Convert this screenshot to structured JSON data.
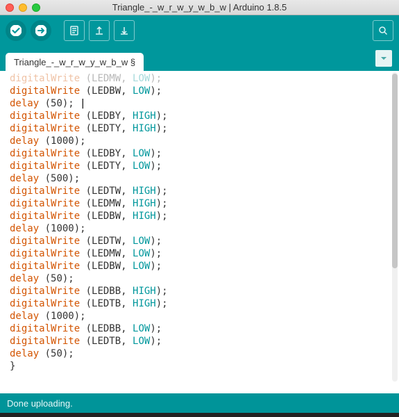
{
  "window": {
    "title": "Triangle_-_w_r_w_y_w_b_w | Arduino 1.8.5"
  },
  "tab": {
    "label": "Triangle_-_w_r_w_y_w_b_w §"
  },
  "status": {
    "text": "Done uploading."
  },
  "code": {
    "lines": [
      {
        "parts": [
          {
            "t": "digitalWrite",
            "c": "cut"
          },
          {
            "t": " (LEDMW, ",
            "c": "cut-plain"
          },
          {
            "t": "LOW",
            "c": "cut-const"
          },
          {
            "t": ");",
            "c": "cut-plain"
          }
        ]
      },
      {
        "parts": [
          {
            "t": "digitalWrite",
            "c": "kw-fn"
          },
          {
            "t": " (LEDBW, ",
            "c": "plain"
          },
          {
            "t": "LOW",
            "c": "kw-const"
          },
          {
            "t": ");",
            "c": "plain"
          }
        ]
      },
      {
        "parts": [
          {
            "t": "delay",
            "c": "kw-fn"
          },
          {
            "t": " (50); ",
            "c": "plain"
          }
        ],
        "caret": true
      },
      {
        "parts": [
          {
            "t": "digitalWrite",
            "c": "kw-fn"
          },
          {
            "t": " (LEDBY, ",
            "c": "plain"
          },
          {
            "t": "HIGH",
            "c": "kw-const"
          },
          {
            "t": ");",
            "c": "plain"
          }
        ]
      },
      {
        "parts": [
          {
            "t": "digitalWrite",
            "c": "kw-fn"
          },
          {
            "t": " (LEDTY, ",
            "c": "plain"
          },
          {
            "t": "HIGH",
            "c": "kw-const"
          },
          {
            "t": ");",
            "c": "plain"
          }
        ]
      },
      {
        "parts": [
          {
            "t": "delay",
            "c": "kw-fn"
          },
          {
            "t": " (1000);",
            "c": "plain"
          }
        ]
      },
      {
        "parts": [
          {
            "t": "digitalWrite",
            "c": "kw-fn"
          },
          {
            "t": " (LEDBY, ",
            "c": "plain"
          },
          {
            "t": "LOW",
            "c": "kw-const"
          },
          {
            "t": ");",
            "c": "plain"
          }
        ]
      },
      {
        "parts": [
          {
            "t": "digitalWrite",
            "c": "kw-fn"
          },
          {
            "t": " (LEDTY, ",
            "c": "plain"
          },
          {
            "t": "LOW",
            "c": "kw-const"
          },
          {
            "t": ");",
            "c": "plain"
          }
        ]
      },
      {
        "parts": [
          {
            "t": "delay",
            "c": "kw-fn"
          },
          {
            "t": " (500);",
            "c": "plain"
          }
        ]
      },
      {
        "parts": [
          {
            "t": "digitalWrite",
            "c": "kw-fn"
          },
          {
            "t": " (LEDTW, ",
            "c": "plain"
          },
          {
            "t": "HIGH",
            "c": "kw-const"
          },
          {
            "t": ");",
            "c": "plain"
          }
        ]
      },
      {
        "parts": [
          {
            "t": "digitalWrite",
            "c": "kw-fn"
          },
          {
            "t": " (LEDMW, ",
            "c": "plain"
          },
          {
            "t": "HIGH",
            "c": "kw-const"
          },
          {
            "t": ");",
            "c": "plain"
          }
        ]
      },
      {
        "parts": [
          {
            "t": "digitalWrite",
            "c": "kw-fn"
          },
          {
            "t": " (LEDBW, ",
            "c": "plain"
          },
          {
            "t": "HIGH",
            "c": "kw-const"
          },
          {
            "t": ");",
            "c": "plain"
          }
        ]
      },
      {
        "parts": [
          {
            "t": "delay",
            "c": "kw-fn"
          },
          {
            "t": " (1000);",
            "c": "plain"
          }
        ]
      },
      {
        "parts": [
          {
            "t": "digitalWrite",
            "c": "kw-fn"
          },
          {
            "t": " (LEDTW, ",
            "c": "plain"
          },
          {
            "t": "LOW",
            "c": "kw-const"
          },
          {
            "t": ");",
            "c": "plain"
          }
        ]
      },
      {
        "parts": [
          {
            "t": "digitalWrite",
            "c": "kw-fn"
          },
          {
            "t": " (LEDMW, ",
            "c": "plain"
          },
          {
            "t": "LOW",
            "c": "kw-const"
          },
          {
            "t": ");",
            "c": "plain"
          }
        ]
      },
      {
        "parts": [
          {
            "t": "digitalWrite",
            "c": "kw-fn"
          },
          {
            "t": " (LEDBW, ",
            "c": "plain"
          },
          {
            "t": "LOW",
            "c": "kw-const"
          },
          {
            "t": ");",
            "c": "plain"
          }
        ]
      },
      {
        "parts": [
          {
            "t": "delay",
            "c": "kw-fn"
          },
          {
            "t": " (50);",
            "c": "plain"
          }
        ]
      },
      {
        "parts": [
          {
            "t": "digitalWrite",
            "c": "kw-fn"
          },
          {
            "t": " (LEDBB, ",
            "c": "plain"
          },
          {
            "t": "HIGH",
            "c": "kw-const"
          },
          {
            "t": ");",
            "c": "plain"
          }
        ]
      },
      {
        "parts": [
          {
            "t": "digitalWrite",
            "c": "kw-fn"
          },
          {
            "t": " (LEDTB, ",
            "c": "plain"
          },
          {
            "t": "HIGH",
            "c": "kw-const"
          },
          {
            "t": ");",
            "c": "plain"
          }
        ]
      },
      {
        "parts": [
          {
            "t": "delay",
            "c": "kw-fn"
          },
          {
            "t": " (1000);",
            "c": "plain"
          }
        ]
      },
      {
        "parts": [
          {
            "t": "digitalWrite",
            "c": "kw-fn"
          },
          {
            "t": " (LEDBB, ",
            "c": "plain"
          },
          {
            "t": "LOW",
            "c": "kw-const"
          },
          {
            "t": ");",
            "c": "plain"
          }
        ]
      },
      {
        "parts": [
          {
            "t": "digitalWrite",
            "c": "kw-fn"
          },
          {
            "t": " (LEDTB, ",
            "c": "plain"
          },
          {
            "t": "LOW",
            "c": "kw-const"
          },
          {
            "t": ");",
            "c": "plain"
          }
        ]
      },
      {
        "parts": [
          {
            "t": "delay",
            "c": "kw-fn"
          },
          {
            "t": " (50);",
            "c": "plain"
          }
        ]
      },
      {
        "parts": [
          {
            "t": "}",
            "c": "plain"
          }
        ]
      }
    ]
  }
}
